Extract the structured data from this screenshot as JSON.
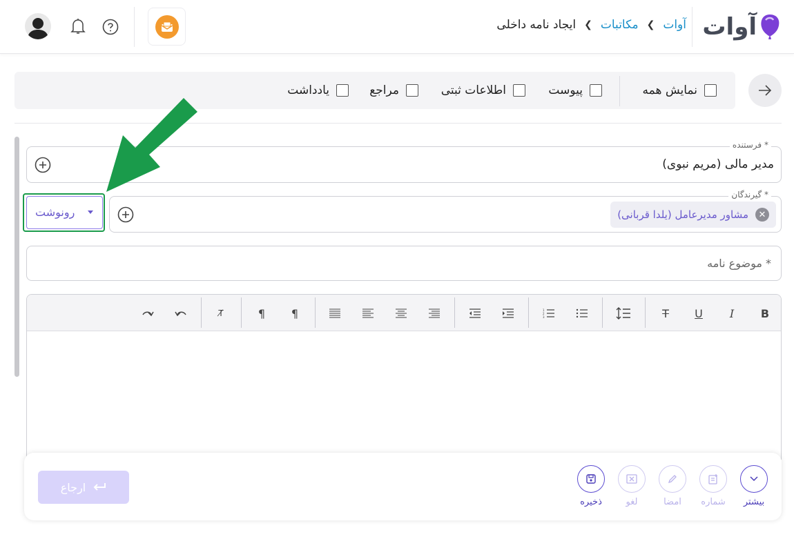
{
  "header": {
    "logo_text": "آوات",
    "breadcrumb": [
      "آوات",
      "مکاتبات",
      "ایجاد نامه داخلی"
    ]
  },
  "filters": {
    "items": [
      {
        "label": "نمایش همه",
        "checked": false
      },
      {
        "label": "پیوست",
        "checked": false
      },
      {
        "label": "اطلاعات ثبتی",
        "checked": false
      },
      {
        "label": "مراجع",
        "checked": false
      },
      {
        "label": "یادداشت",
        "checked": false
      }
    ]
  },
  "form": {
    "sender_label": "فرستنده *",
    "sender_value": "مدیر مالی (مریم نبوی)",
    "recipients_label": "گیرندگان *",
    "recipient_chip": "مشاور مدیرعامل (یلدا قربانی)",
    "copy_select_value": "رونوشت",
    "subject_placeholder": "موضوع نامه *"
  },
  "editor": {
    "toolbar": [
      "bold",
      "italic",
      "underline",
      "strikethrough",
      "line-height",
      "bullet-list",
      "numbered-list",
      "indent",
      "outdent",
      "align-right",
      "align-center",
      "align-left",
      "justify",
      "rtl-paragraph",
      "ltr-paragraph",
      "clear-format",
      "undo",
      "redo"
    ]
  },
  "actions": {
    "more": "بیشتر",
    "number": "شماره",
    "sign": "امضا",
    "cancel": "لغو",
    "save": "ذخیره",
    "return": "ارجاع"
  },
  "colors": {
    "accent": "#6a5acd",
    "link": "#1a8fc9",
    "highlight": "#1a9b4b"
  }
}
